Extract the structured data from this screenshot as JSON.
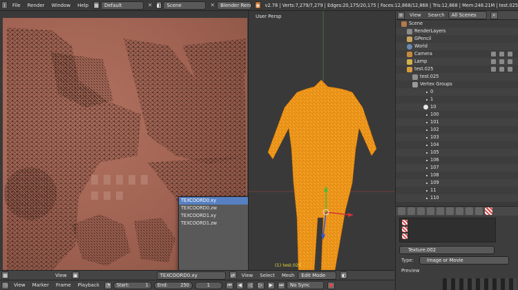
{
  "topbar": {
    "menus": [
      "File",
      "Render",
      "Window",
      "Help"
    ],
    "layout": "Default",
    "scene": "Scene",
    "engine": "Blender Render",
    "stats": "v2.78 | Verts:7,279/7,279 | Edges:20,175/20,175 | Faces:12,868/12,868 | Tris:12,868 | Mem:248.21M | test.025"
  },
  "viewport": {
    "title": "User Persp",
    "object_label": "(1) test.025"
  },
  "popup": {
    "items": [
      "TEXCOORD0.xy",
      "TEXCOORD0.zw",
      "TEXCOORD1.xy",
      "TEXCOORD1.zw"
    ]
  },
  "outliner": {
    "header": {
      "view": "View",
      "search": "Search",
      "filter": "All Scenes"
    },
    "rows": [
      "Scene",
      "RenderLayers",
      "GPencil",
      "World",
      "Camera",
      "Lamp",
      "test.025",
      "test.025",
      "Vertex Groups",
      "0",
      "1",
      "10",
      "100",
      "101",
      "102",
      "103",
      "104",
      "105",
      "106",
      "107",
      "108",
      "109",
      "11",
      "110"
    ]
  },
  "properties": {
    "texture_name": "Texture.002",
    "type_label": "Type:",
    "type_value": "Image or Movie",
    "preview_label": "Preview"
  },
  "uv_header": {
    "view": "View",
    "uvmap": "TEXCOORD0.xy",
    "view3d": "View",
    "select": "Select",
    "mesh": "Mesh",
    "mode": "Edit Mode"
  },
  "timeline": {
    "view": "View",
    "marker": "Marker",
    "frame": "Frame",
    "playback": "Playback",
    "start_label": "Start:",
    "start": "1",
    "end_label": "End:",
    "end": "250",
    "current": "1",
    "sync": "No Sync"
  }
}
